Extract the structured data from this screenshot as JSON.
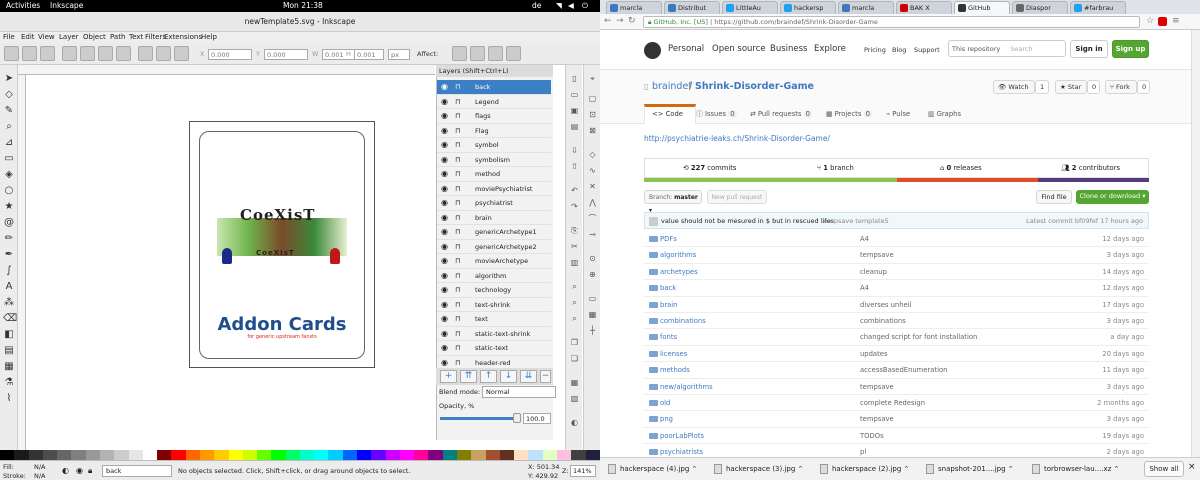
{
  "topbar": {
    "activities": "Activities",
    "app": "Inkscape",
    "clock": "Mon 21:38",
    "lang": "de"
  },
  "inkscape": {
    "title": "newTemplate5.svg - Inkscape",
    "menu": [
      "File",
      "Edit",
      "View",
      "Layer",
      "Object",
      "Path",
      "Text",
      "Filters",
      "Extensions",
      "Help"
    ],
    "controls": {
      "x_label": "X",
      "x_val": "0.000",
      "y_label": "Y",
      "y_val": "0.000",
      "w_label": "W",
      "w_val": "0.001",
      "h_label": "H",
      "h_val": "0.001",
      "unit": "px",
      "affect": "Affect:"
    },
    "card": {
      "logo_text": "CoeXisT",
      "logo_sub": "CoeXIsT",
      "title": "Addon Cards",
      "subtitle": "for generic upstream fansts"
    },
    "layers_title": "Layers (Shift+Ctrl+L)",
    "layers": [
      "back",
      "Legend",
      "flags",
      "Flag",
      "symbol",
      "symbolism",
      "method",
      "moviePsychiatrist",
      "psychiatrist",
      "brain",
      "genericArchetype1",
      "genericArchetype2",
      "movieArchetype",
      "algorithm",
      "technology",
      "text-shrink",
      "text",
      "static-text-shrink",
      "static-text",
      "header-red"
    ],
    "blend_label": "Blend mode:",
    "blend_value": "Normal",
    "opacity_label": "Opacity, %",
    "opacity_value": "100.0",
    "status": {
      "fill_label": "Fill:",
      "fill_val": "N/A",
      "stroke_label": "Stroke:",
      "stroke_val": "N/A",
      "layer": "back",
      "message": "No objects selected. Click, Shift+click, or drag around objects to select.",
      "x": "X: 501.34",
      "y": "Y: 429.92",
      "z_label": "Z:",
      "zoom": "141%"
    },
    "palette": [
      "#000000",
      "#1a1a1a",
      "#333333",
      "#4d4d4d",
      "#666666",
      "#808080",
      "#999999",
      "#b3b3b3",
      "#cccccc",
      "#e6e6e6",
      "#ffffff",
      "#800000",
      "#ff0000",
      "#ff6600",
      "#ff9900",
      "#ffcc00",
      "#ffff00",
      "#ccff00",
      "#66ff00",
      "#00ff00",
      "#00ff66",
      "#00ffcc",
      "#00ffff",
      "#00ccff",
      "#0066ff",
      "#0000ff",
      "#6600ff",
      "#cc00ff",
      "#ff00ff",
      "#ff0099",
      "#800080",
      "#008080",
      "#808000",
      "#c8a060",
      "#a05030",
      "#603020",
      "#ffe0c0",
      "#c0e0ff",
      "#e0ffc0",
      "#ffc0e0",
      "#404040",
      "#202040"
    ]
  },
  "browser": {
    "tabs": [
      "marcla",
      "Distribut",
      "LittleAu",
      "hackersp",
      "marcla",
      "BAK X",
      "GitHub",
      "Diaspor",
      "#farbrau"
    ],
    "active_tab": 6,
    "url_prefix": "GitHub, Inc. [US]",
    "url": "https://github.com/braindef/Shrink-Disorder-Game",
    "nav": [
      "Personal",
      "Open source",
      "Business",
      "Explore"
    ],
    "subnav": [
      "Pricing",
      "Blog",
      "Support"
    ],
    "search_scope": "This repository",
    "search_placeholder": "Search",
    "signin": "Sign in",
    "signup": "Sign up",
    "owner": "braindef",
    "repo": "Shrink-Disorder-Game",
    "watch": "Watch",
    "watch_count": "1",
    "star": "Star",
    "star_count": "0",
    "fork": "Fork",
    "fork_count": "0",
    "repo_tabs": [
      {
        "label": "Code",
        "count": ""
      },
      {
        "label": "Issues",
        "count": "0"
      },
      {
        "label": "Pull requests",
        "count": "0"
      },
      {
        "label": "Projects",
        "count": "0"
      },
      {
        "label": "Pulse",
        "count": ""
      },
      {
        "label": "Graphs",
        "count": ""
      }
    ],
    "description_link": "http://psychiatrie-leaks.ch/Shrink-Disorder-Game/",
    "stats": {
      "commits": "227",
      "commits_label": "commits",
      "branch": "1",
      "branch_label": "branch",
      "releases": "0",
      "releases_label": "releases",
      "contributors": "2",
      "contributors_label": "contributors"
    },
    "lang_colors": [
      "#8cc34a",
      "#e34c26",
      "#563d7c"
    ],
    "branch_label": "Branch:",
    "branch_name": "master",
    "new_pr": "New pull request",
    "find_file": "Find file",
    "clone": "Clone or download",
    "commit_msg": "value should not be mesured in $ but in rescued lifes",
    "commit_sub": "tempsave template5",
    "latest_commit": "Latest commit bf09fef 17 hours ago",
    "files": [
      {
        "name": "PDFs",
        "msg": "A4",
        "age": "12 days ago"
      },
      {
        "name": "algorithms",
        "msg": "tempsave",
        "age": "3 days ago"
      },
      {
        "name": "archetypes",
        "msg": "cleanup",
        "age": "14 days ago"
      },
      {
        "name": "back",
        "msg": "A4",
        "age": "12 days ago"
      },
      {
        "name": "brain",
        "msg": "diverses unheil",
        "age": "17 days ago"
      },
      {
        "name": "combinations",
        "msg": "combinations",
        "age": "3 days ago"
      },
      {
        "name": "fonts",
        "msg": "changed script for font installation",
        "age": "a day ago"
      },
      {
        "name": "licenses",
        "msg": "updates",
        "age": "20 days ago"
      },
      {
        "name": "methods",
        "msg": "accessBasedEnumeration",
        "age": "11 days ago"
      },
      {
        "name": "new/algorithms",
        "msg": "tempsave",
        "age": "3 days ago"
      },
      {
        "name": "old",
        "msg": "complete Redesign",
        "age": "2 months ago"
      },
      {
        "name": "png",
        "msg": "tempsave",
        "age": "3 days ago"
      },
      {
        "name": "poorLabPlots",
        "msg": "TODOs",
        "age": "19 days ago"
      },
      {
        "name": "psychiatrists",
        "msg": "pl",
        "age": "2 days ago"
      }
    ],
    "downloads": [
      "hackerspace (4).jpg",
      "hackerspace (3).jpg",
      "hackerspace (2).jpg",
      "snapshot-201....jpg",
      "torbrowser-lau....xz"
    ],
    "show_all": "Show all"
  }
}
